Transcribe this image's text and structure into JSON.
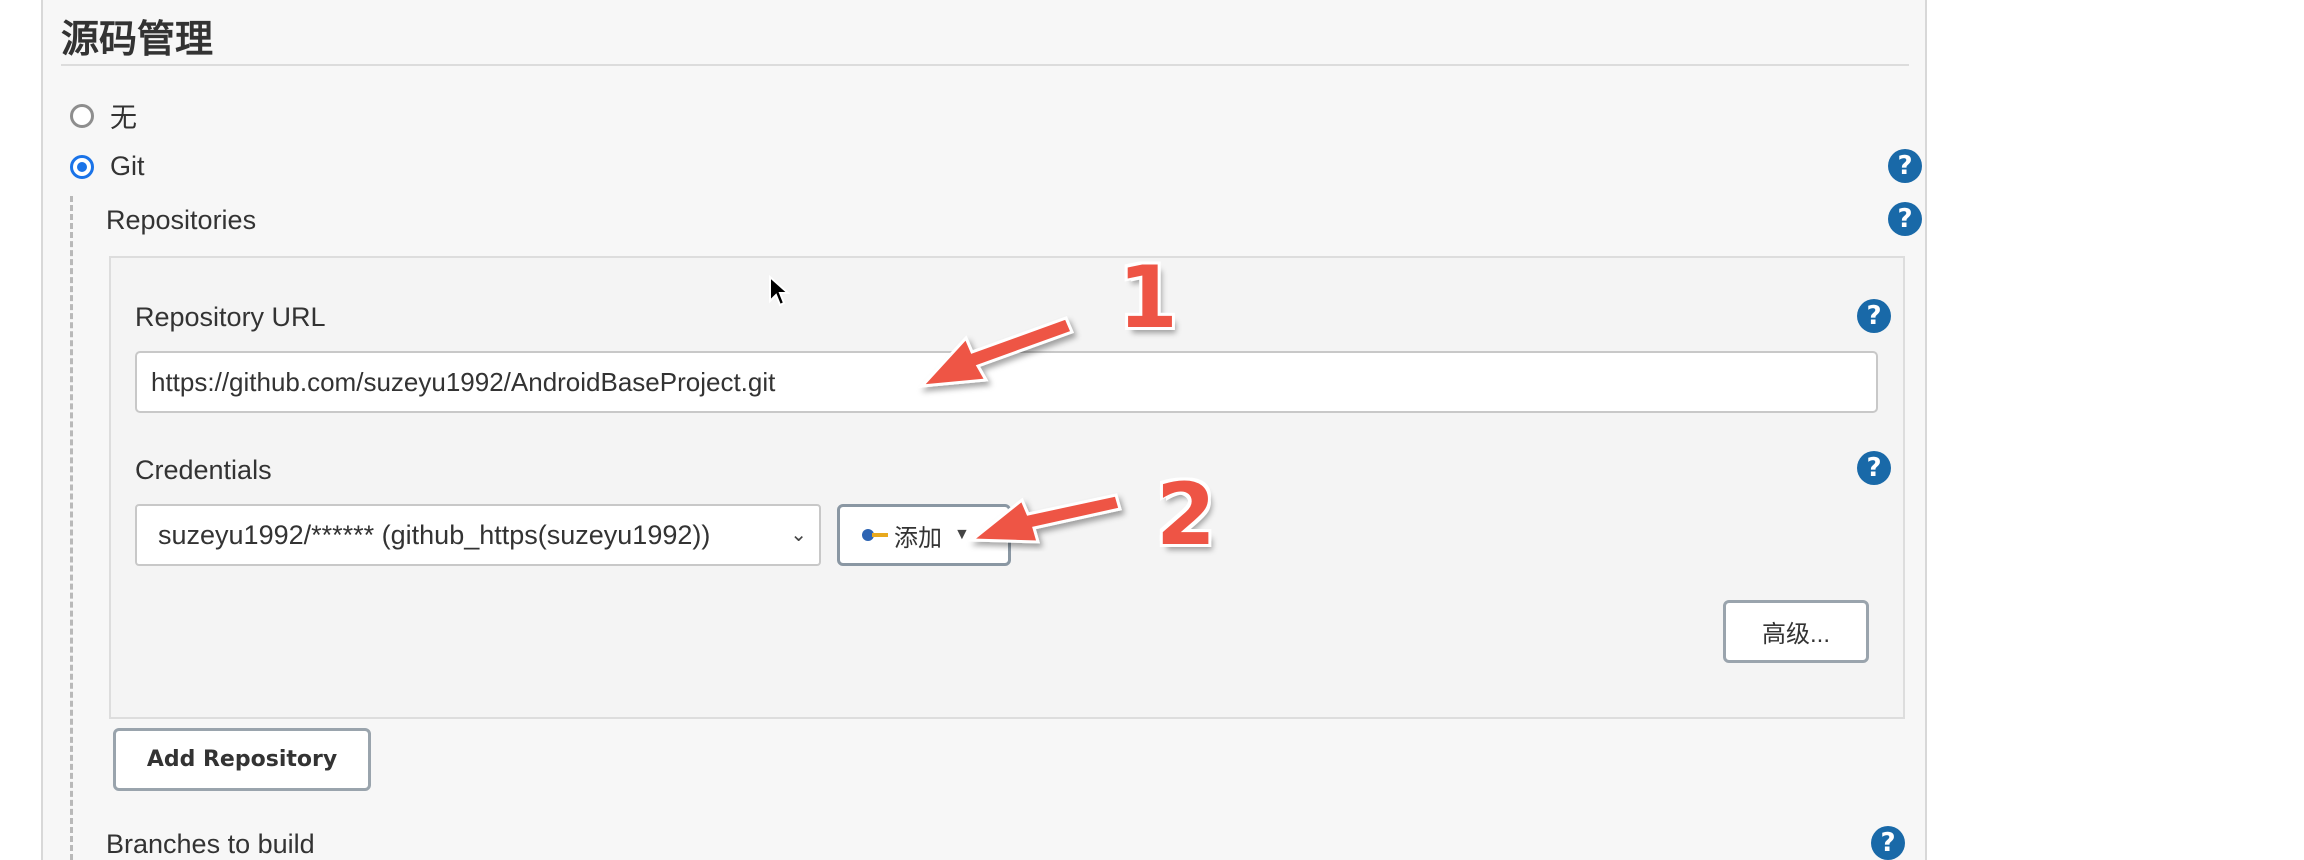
{
  "section": {
    "title": "源码管理"
  },
  "scm": {
    "options": [
      {
        "label": "无",
        "checked": false
      },
      {
        "label": "Git",
        "checked": true
      }
    ]
  },
  "repositories": {
    "label": "Repositories",
    "repository_url": {
      "label": "Repository URL",
      "value": "https://github.com/suzeyu1992/AndroidBaseProject.git"
    },
    "credentials": {
      "label": "Credentials",
      "selected": "suzeyu1992/****** (github_https(suzeyu1992))",
      "add_label": "添加"
    },
    "advanced_label": "高级...",
    "add_repository_label": "Add Repository"
  },
  "branches": {
    "label": "Branches to build"
  },
  "annotations": {
    "marker1": "1",
    "marker2": "2",
    "color": "#ee5445"
  },
  "icons": {
    "help": "help-icon",
    "key": "key-icon",
    "dropdown": "chevron-down-icon"
  },
  "help_glyph": "?"
}
